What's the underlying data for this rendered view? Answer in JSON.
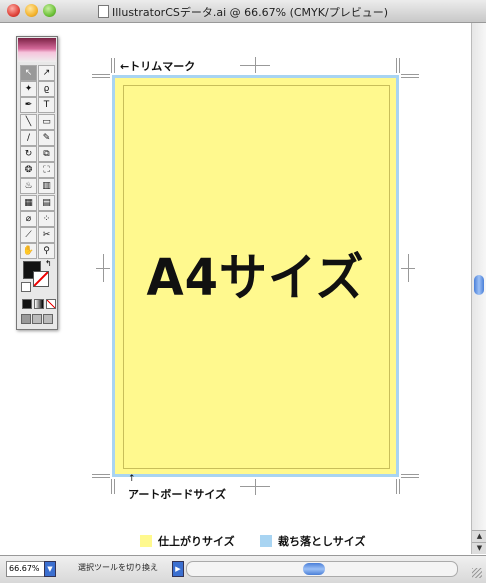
{
  "window": {
    "title": "IllustratorCSデータ.ai @ 66.67% (CMYK/プレビュー)"
  },
  "artboard": {
    "main_text": "A4サイズ",
    "trim_label": "←トリムマーク",
    "artboard_label": "アートボードサイズ",
    "artboard_arrow": "↑"
  },
  "legend": {
    "finish_label": "仕上がりサイズ",
    "finish_color": "#fff98e",
    "bleed_label": "裁ち落としサイズ",
    "bleed_color": "#a8d4f2"
  },
  "status": {
    "zoom_value": "66.67%",
    "tool_text": "選択ツールを切り換え"
  },
  "tools": [
    {
      "name": "selection-tool-icon",
      "glyph": "↖"
    },
    {
      "name": "direct-selection-tool-icon",
      "glyph": "↗"
    },
    {
      "name": "magic-wand-tool-icon",
      "glyph": "✦"
    },
    {
      "name": "lasso-tool-icon",
      "glyph": "ϱ"
    },
    {
      "name": "pen-tool-icon",
      "glyph": "✒"
    },
    {
      "name": "type-tool-icon",
      "glyph": "T"
    },
    {
      "name": "line-tool-icon",
      "glyph": "╲"
    },
    {
      "name": "rectangle-tool-icon",
      "glyph": "▭"
    },
    {
      "name": "paintbrush-tool-icon",
      "glyph": "∕"
    },
    {
      "name": "pencil-tool-icon",
      "glyph": "✎"
    },
    {
      "name": "rotate-tool-icon",
      "glyph": "↻"
    },
    {
      "name": "scale-tool-icon",
      "glyph": "⧉"
    },
    {
      "name": "warp-tool-icon",
      "glyph": "❂"
    },
    {
      "name": "free-transform-tool-icon",
      "glyph": "⛶"
    },
    {
      "name": "symbol-sprayer-tool-icon",
      "glyph": "♨"
    },
    {
      "name": "graph-tool-icon",
      "glyph": "▥"
    },
    {
      "name": "mesh-tool-icon",
      "glyph": "▦"
    },
    {
      "name": "gradient-tool-icon",
      "glyph": "▤"
    },
    {
      "name": "eyedropper-tool-icon",
      "glyph": "⌀"
    },
    {
      "name": "blend-tool-icon",
      "glyph": "⁘"
    },
    {
      "name": "slice-tool-icon",
      "glyph": "⟋"
    },
    {
      "name": "scissors-tool-icon",
      "glyph": "✂"
    },
    {
      "name": "hand-tool-icon",
      "glyph": "✋"
    },
    {
      "name": "zoom-tool-icon",
      "glyph": "⚲"
    }
  ]
}
